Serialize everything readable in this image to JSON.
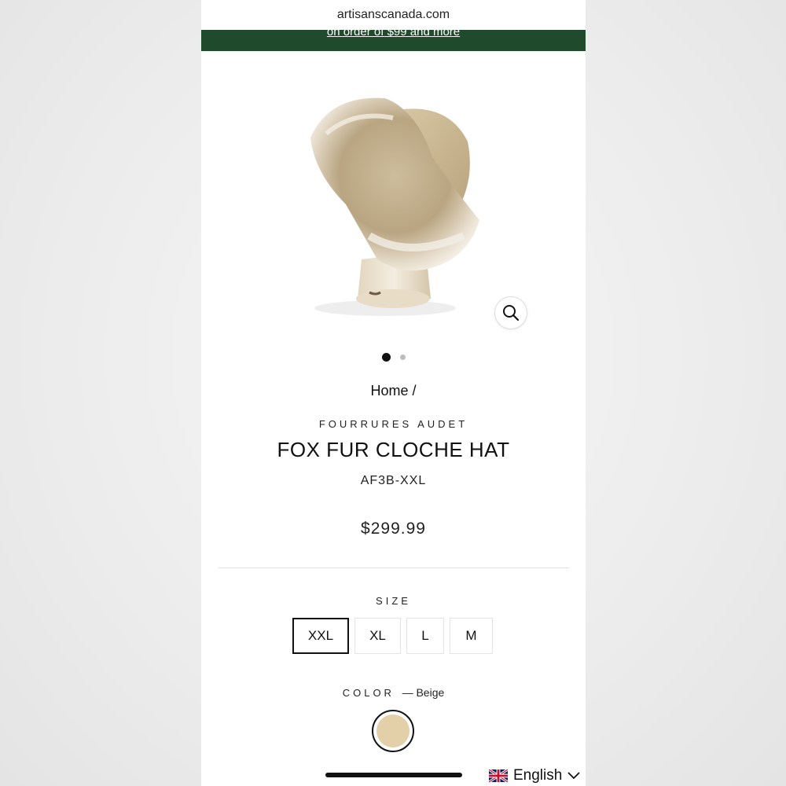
{
  "browser": {
    "url": "artisanscanada.com"
  },
  "promo_banner": {
    "text": "on order of $99 and more"
  },
  "gallery": {
    "zoom_icon": "magnifier-icon",
    "slide_count": 2,
    "active_slide": 1
  },
  "breadcrumb": {
    "text": "Home /"
  },
  "product": {
    "vendor": "FOURRURES AUDET",
    "title": "FOX FUR CLOCHE HAT",
    "sku": "AF3B-XXL",
    "price": "$299.99"
  },
  "size": {
    "label": "SIZE",
    "options": [
      "XXL",
      "XL",
      "L",
      "M"
    ],
    "selected": "XXL"
  },
  "color": {
    "label": "COLOR",
    "value": "— Beige",
    "swatch_hex": "#e3cfa8"
  },
  "language": {
    "label": "English",
    "flag_icon": "uk-flag-icon",
    "chevron_icon": "chevron-down-icon"
  },
  "colors": {
    "promo_bg": "#1f4a2c"
  }
}
